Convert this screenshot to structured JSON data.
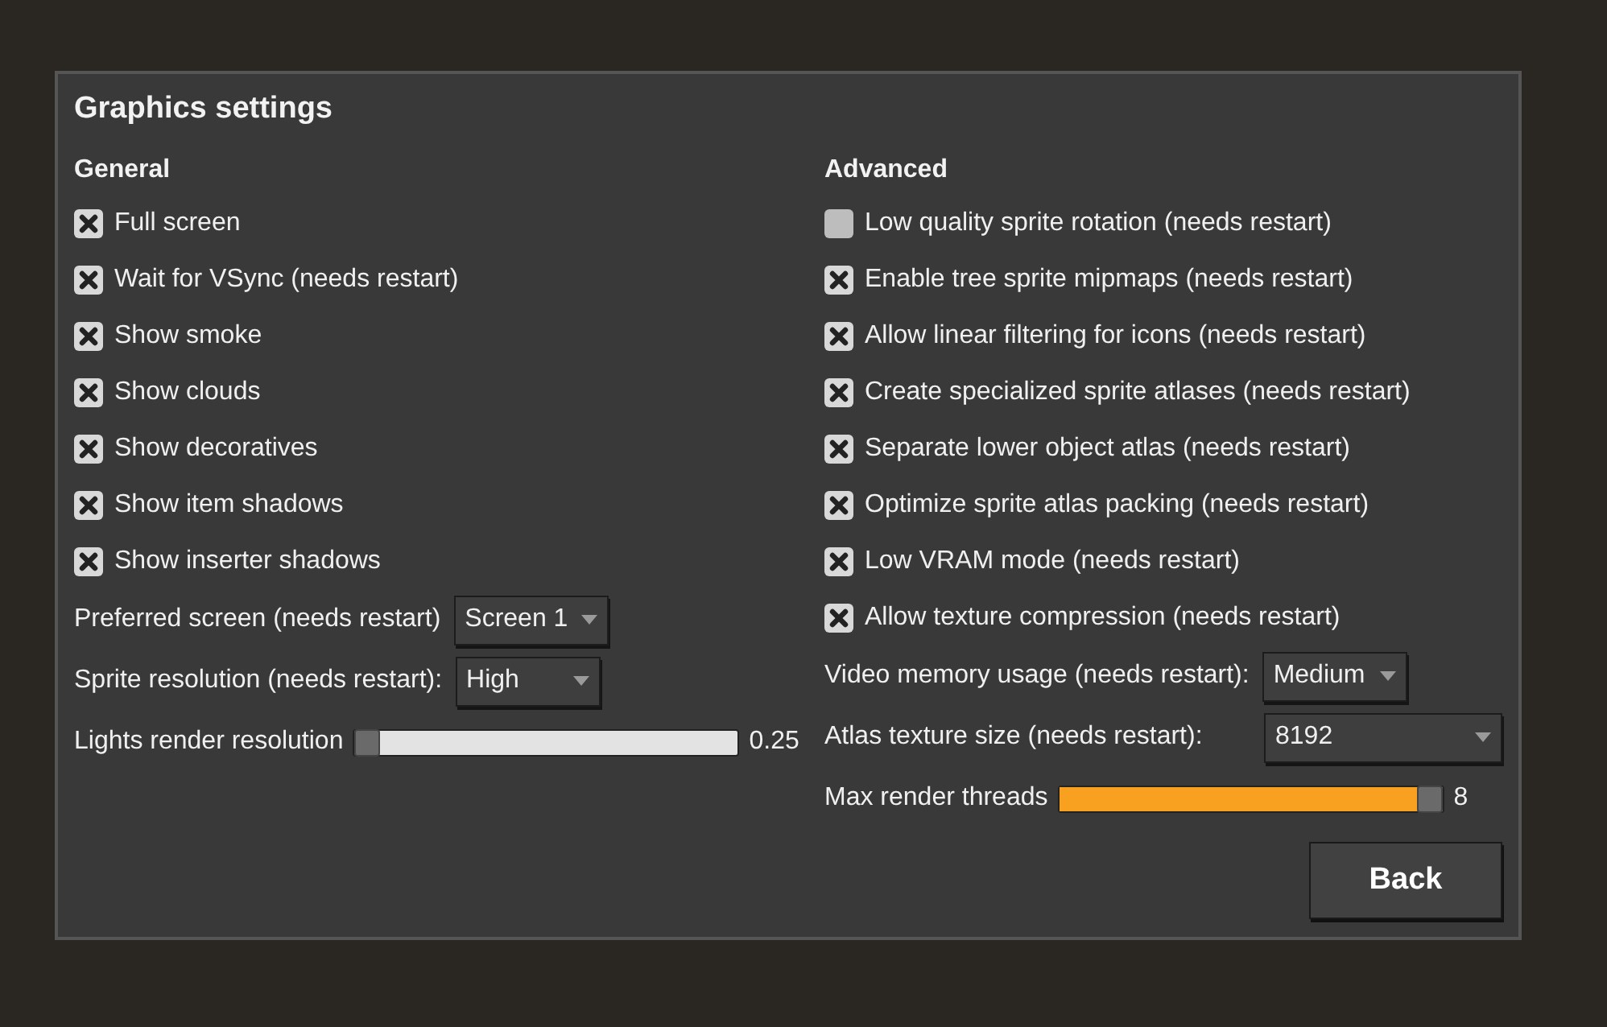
{
  "dialog": {
    "title": "Graphics settings",
    "button": "Back"
  },
  "columns": [
    {
      "heading": "General",
      "items": [
        {
          "kind": "checkbox",
          "label": "Full screen",
          "checked": true
        },
        {
          "kind": "checkbox",
          "label": "Wait for VSync (needs restart)",
          "checked": true
        },
        {
          "kind": "checkbox",
          "label": "Show smoke",
          "checked": true
        },
        {
          "kind": "checkbox",
          "label": "Show clouds",
          "checked": true
        },
        {
          "kind": "checkbox",
          "label": "Show decoratives",
          "checked": true
        },
        {
          "kind": "checkbox",
          "label": "Show item shadows",
          "checked": true
        },
        {
          "kind": "checkbox",
          "label": "Show inserter shadows",
          "checked": true
        },
        {
          "kind": "dropdown",
          "label": "Preferred screen (needs restart)",
          "value": "Screen 1"
        },
        {
          "kind": "dropdown",
          "label": "Sprite resolution (needs restart):",
          "value": "High"
        },
        {
          "kind": "slider",
          "label": "Lights render resolution",
          "level": 0,
          "reading": "0.25"
        }
      ]
    },
    {
      "heading": "Advanced",
      "items": [
        {
          "kind": "checkbox",
          "label": "Low quality sprite rotation (needs restart)",
          "checked": false
        },
        {
          "kind": "checkbox",
          "label": "Enable tree sprite mipmaps (needs restart)",
          "checked": true
        },
        {
          "kind": "checkbox",
          "label": "Allow linear filtering for icons (needs restart)",
          "checked": true
        },
        {
          "kind": "checkbox",
          "label": "Create specialized sprite atlases (needs restart)",
          "checked": true
        },
        {
          "kind": "checkbox",
          "label": "Separate lower object atlas (needs restart)",
          "checked": true
        },
        {
          "kind": "checkbox",
          "label": "Optimize sprite atlas packing (needs restart)",
          "checked": true
        },
        {
          "kind": "checkbox",
          "label": "Low VRAM mode (needs restart)",
          "checked": true
        },
        {
          "kind": "checkbox",
          "label": "Allow texture compression (needs restart)",
          "checked": true
        },
        {
          "kind": "dropdown",
          "label": "Video memory usage (needs restart):",
          "value": "Medium"
        },
        {
          "kind": "dropdown",
          "label": "Atlas texture size (needs restart):",
          "value": "8192",
          "wide": true
        },
        {
          "kind": "slider",
          "label": "Max render threads",
          "level": 1,
          "reading": "8"
        }
      ]
    }
  ]
}
